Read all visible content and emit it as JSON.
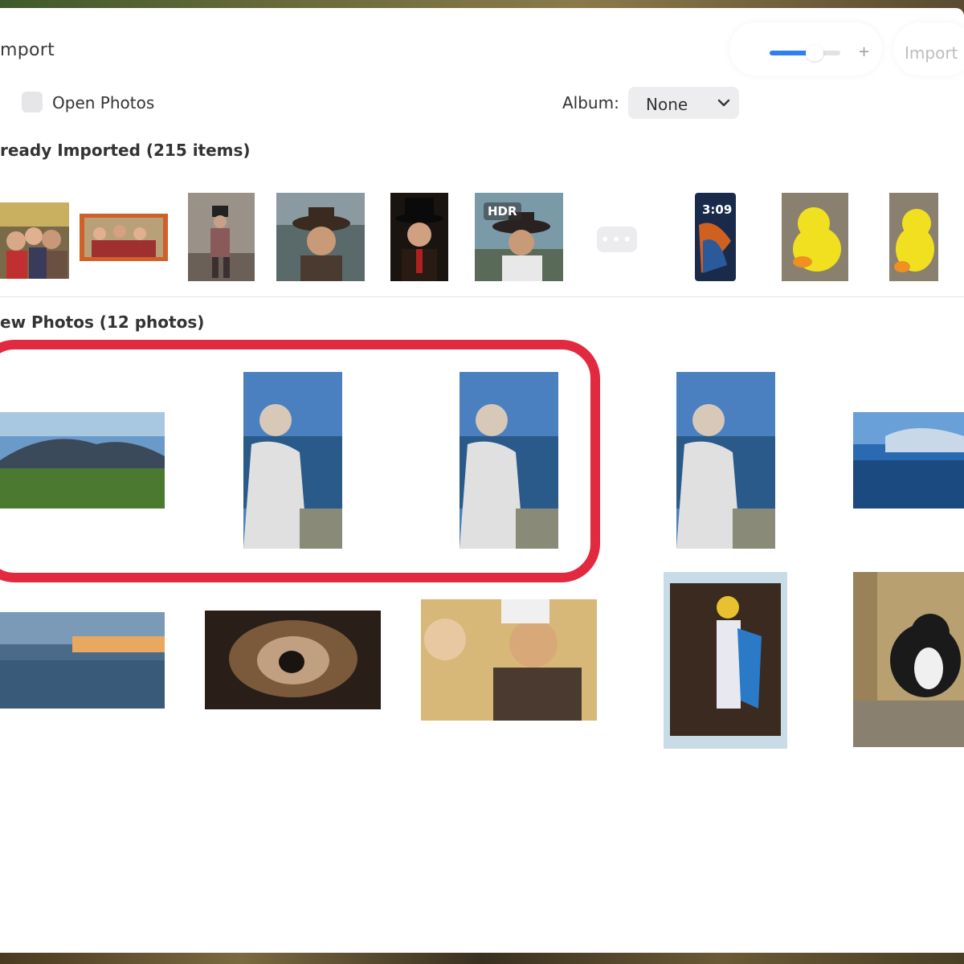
{
  "window": {
    "title": "mport"
  },
  "toolbar": {
    "zoom_level": 0.55,
    "plus_label": "+",
    "import_label": "Import"
  },
  "options": {
    "open_photos_label": "Open Photos",
    "open_photos_checked": false,
    "album_label": "Album:",
    "album_value": "None"
  },
  "sections": {
    "already_imported": "ready Imported (215 items)",
    "new_photos": "ew Photos (12 photos)"
  },
  "imported_thumbs": [
    {
      "subject": "group selfie"
    },
    {
      "subject": "group photo print"
    },
    {
      "subject": "man in top hat"
    },
    {
      "subject": "cowboy portrait"
    },
    {
      "subject": "man in top hat portrait"
    },
    {
      "subject": "cowboy portrait",
      "badge": "HDR"
    },
    {
      "subject": "more"
    },
    {
      "subject": "phone lock screen",
      "badge": "3:09"
    },
    {
      "subject": "rubber duck"
    },
    {
      "subject": "rubber duck"
    }
  ],
  "more_label": "•••",
  "new_thumbs_row1": [
    {
      "subject": "mountain meadow"
    },
    {
      "subject": "woman by sea"
    },
    {
      "subject": "woman by sea"
    },
    {
      "subject": "woman by sea"
    },
    {
      "subject": "beach reflection"
    }
  ],
  "new_thumbs_row2": [
    {
      "subject": "sunset beach"
    },
    {
      "subject": "nebula"
    },
    {
      "subject": "people smiling"
    },
    {
      "subject": "child costume print"
    },
    {
      "subject": "cat on chair"
    }
  ],
  "colors": {
    "accent": "#2d7ff2",
    "highlight": "#e12a3f"
  }
}
